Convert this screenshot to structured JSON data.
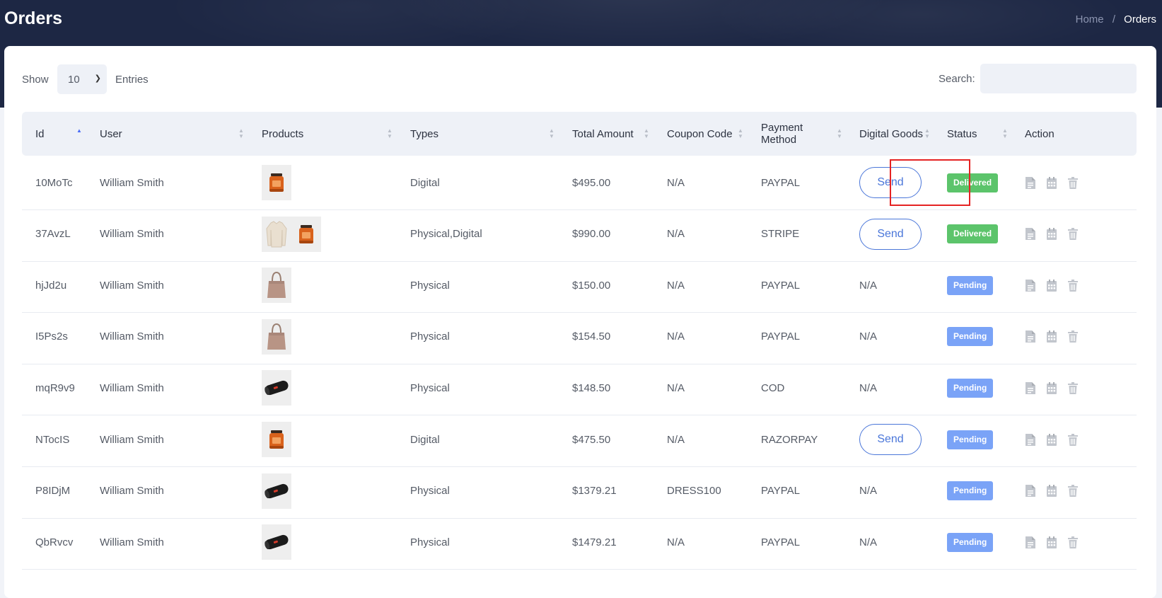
{
  "header": {
    "title": "Orders",
    "breadcrumb": {
      "home": "Home",
      "separator": "/",
      "current": "Orders"
    }
  },
  "controls": {
    "show_label": "Show",
    "page_size": "10",
    "entries_label": "Entries",
    "search_label": "Search:",
    "search_value": ""
  },
  "columns": {
    "id": "Id",
    "user": "User",
    "products": "Products",
    "types": "Types",
    "total": "Total Amount",
    "coupon": "Coupon Code",
    "payment_line1": "Payment",
    "payment_line2": "Method",
    "digital": "Digital Goods",
    "status": "Status",
    "action": "Action"
  },
  "send_label": "Send",
  "rows": [
    {
      "id": "10MoTc",
      "user": "William Smith",
      "products": [
        "candle"
      ],
      "types": "Digital",
      "total": "$495.00",
      "coupon": "N/A",
      "payment": "PAYPAL",
      "digital": "Send",
      "status": "Delivered"
    },
    {
      "id": "37AvzL",
      "user": "William Smith",
      "products": [
        "sweater",
        "candle"
      ],
      "types": "Physical,Digital",
      "total": "$990.00",
      "coupon": "N/A",
      "payment": "STRIPE",
      "digital": "Send",
      "status": "Delivered"
    },
    {
      "id": "hjJd2u",
      "user": "William Smith",
      "products": [
        "tote-bag"
      ],
      "types": "Physical",
      "total": "$150.00",
      "coupon": "N/A",
      "payment": "PAYPAL",
      "digital": "N/A",
      "status": "Pending"
    },
    {
      "id": "I5Ps2s",
      "user": "William Smith",
      "products": [
        "tote-bag"
      ],
      "types": "Physical",
      "total": "$154.50",
      "coupon": "N/A",
      "payment": "PAYPAL",
      "digital": "N/A",
      "status": "Pending"
    },
    {
      "id": "mqR9v9",
      "user": "William Smith",
      "products": [
        "speaker"
      ],
      "types": "Physical",
      "total": "$148.50",
      "coupon": "N/A",
      "payment": "COD",
      "digital": "N/A",
      "status": "Pending"
    },
    {
      "id": "NTocIS",
      "user": "William Smith",
      "products": [
        "candle"
      ],
      "types": "Digital",
      "total": "$475.50",
      "coupon": "N/A",
      "payment": "RAZORPAY",
      "digital": "Send",
      "status": "Pending"
    },
    {
      "id": "P8IDjM",
      "user": "William Smith",
      "products": [
        "speaker"
      ],
      "types": "Physical",
      "total": "$1379.21",
      "coupon": "DRESS100",
      "payment": "PAYPAL",
      "digital": "N/A",
      "status": "Pending"
    },
    {
      "id": "QbRvcv",
      "user": "William Smith",
      "products": [
        "speaker"
      ],
      "types": "Physical",
      "total": "$1479.21",
      "coupon": "N/A",
      "payment": "PAYPAL",
      "digital": "N/A",
      "status": "Pending"
    }
  ],
  "icons": {
    "sort": "sort-icon",
    "invoice": "invoice-icon",
    "calendar": "calendar-icon",
    "delete": "trash-icon"
  },
  "colors": {
    "header_bg": "#1d2744",
    "delivered": "#5cc46b",
    "pending": "#7aa3f7",
    "send": "#4a76d9",
    "highlight": "#e52323"
  }
}
